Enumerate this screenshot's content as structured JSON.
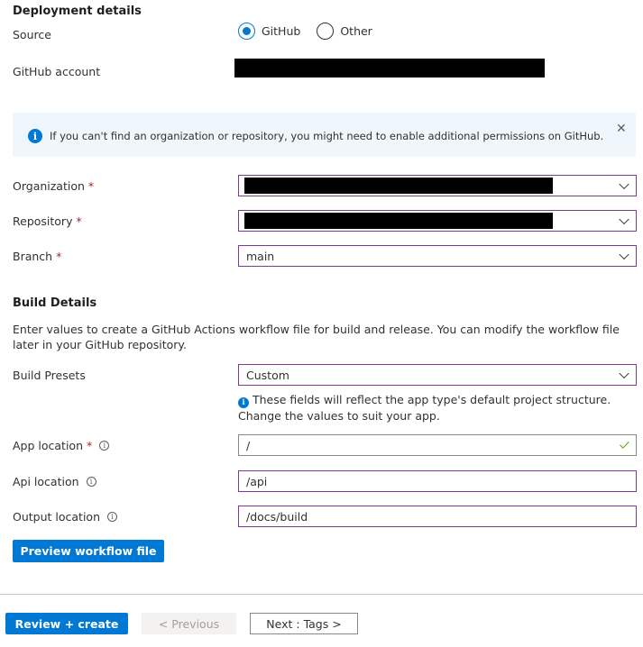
{
  "deployment": {
    "title": "Deployment details",
    "source_label": "Source",
    "source_options": [
      "GitHub",
      "Other"
    ],
    "selected_source": "GitHub",
    "github_account_label": "GitHub account"
  },
  "infobar": {
    "message": "If you can't find an organization or repository, you might need to enable additional permissions on GitHub."
  },
  "repo": {
    "organization_label": "Organization",
    "repository_label": "Repository",
    "branch_label": "Branch",
    "branch_value": "main",
    "required_mark": "*"
  },
  "build": {
    "title": "Build Details",
    "description": "Enter values to create a GitHub Actions workflow file for build and release. You can modify the workflow file later in your GitHub repository.",
    "presets_label": "Build Presets",
    "presets_value": "Custom",
    "presets_hint": "These fields will reflect the app type's default project structure. Change the values to suit your app.",
    "app_location_label": "App location",
    "app_location_value": "/",
    "api_location_label": "Api location",
    "api_location_value": "/api",
    "output_location_label": "Output location",
    "output_location_value": "/docs/build",
    "preview_button": "Preview workflow file"
  },
  "footer": {
    "review_create": "Review + create",
    "previous": "< Previous",
    "next": "Next : Tags >"
  },
  "colors": {
    "accent": "#0078d4",
    "field_border": "#7e3a93",
    "required": "#a4262c",
    "success": "#57a300",
    "info_background": "#eff6fc"
  }
}
